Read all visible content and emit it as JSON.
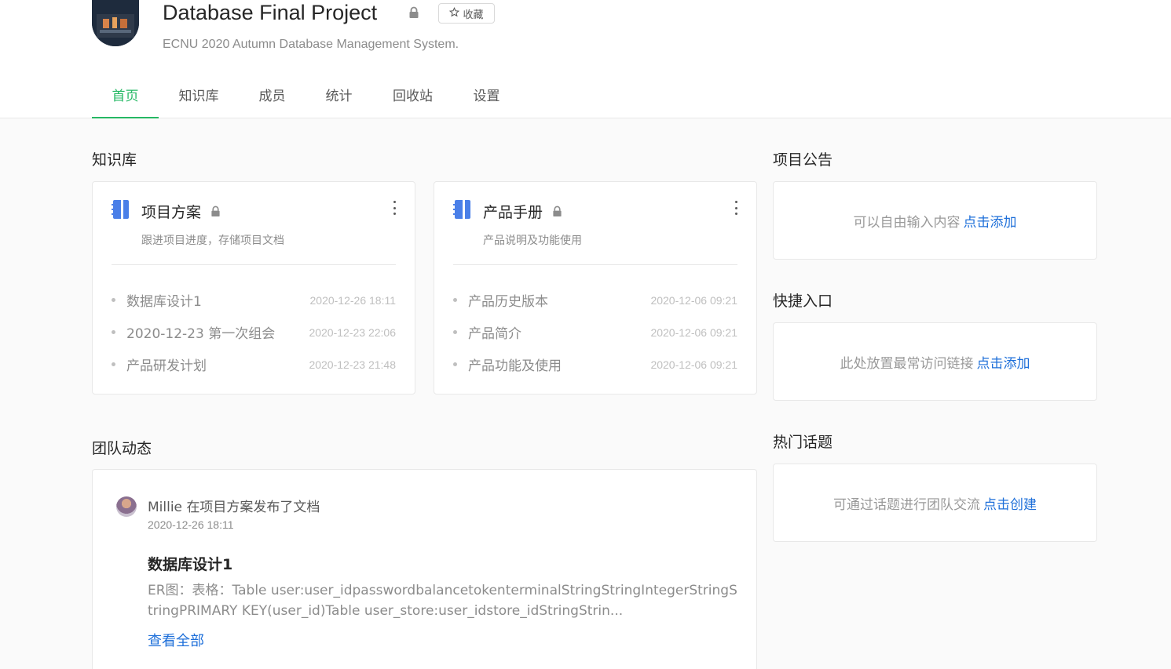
{
  "project": {
    "title": "Database Final Project",
    "favorite_label": "收藏",
    "subtitle": "ECNU 2020 Autumn Database Management System."
  },
  "tabs": [
    {
      "label": "首页",
      "active": true
    },
    {
      "label": "知识库"
    },
    {
      "label": "成员"
    },
    {
      "label": "统计"
    },
    {
      "label": "回收站"
    },
    {
      "label": "设置"
    }
  ],
  "knowledge_base": {
    "heading": "知识库",
    "books": [
      {
        "name": "项目方案",
        "description": "跟进项目进度，存储项目文档",
        "docs": [
          {
            "title": "数据库设计1",
            "time": "2020-12-26 18:11"
          },
          {
            "title": "2020-12-23 第一次组会",
            "time": "2020-12-23 22:06"
          },
          {
            "title": "产品研发计划",
            "time": "2020-12-23 21:48"
          }
        ]
      },
      {
        "name": "产品手册",
        "description": "产品说明及功能使用",
        "docs": [
          {
            "title": "产品历史版本",
            "time": "2020-12-06 09:21"
          },
          {
            "title": "产品简介",
            "time": "2020-12-06 09:21"
          },
          {
            "title": "产品功能及使用",
            "time": "2020-12-06 09:21"
          }
        ]
      }
    ]
  },
  "activity": {
    "heading": "团队动态",
    "items": [
      {
        "user": "Millie",
        "action": "在项目方案发布了文档",
        "time": "2020-12-26 18:11",
        "doc_title": "数据库设计1",
        "excerpt": "ER图：表格：Table user:user_idpasswordbalancetokenterminalStringStringIntegerStringStringPRIMARY KEY(user_id)Table user_store:user_idstore_idStringStrin...",
        "view_all": "查看全部"
      }
    ]
  },
  "sidebar": {
    "announcement": {
      "heading": "项目公告",
      "text": "可以自由输入内容",
      "link": "点击添加"
    },
    "shortcuts": {
      "heading": "快捷入口",
      "text": "此处放置最常访问链接",
      "link": "点击添加"
    },
    "topics": {
      "heading": "热门话题",
      "text": "可通过话题进行团队交流",
      "link": "点击创建"
    }
  },
  "colors": {
    "accent": "#25b864",
    "link": "#1e6fd9",
    "book_icon": "#4a7fe8"
  }
}
